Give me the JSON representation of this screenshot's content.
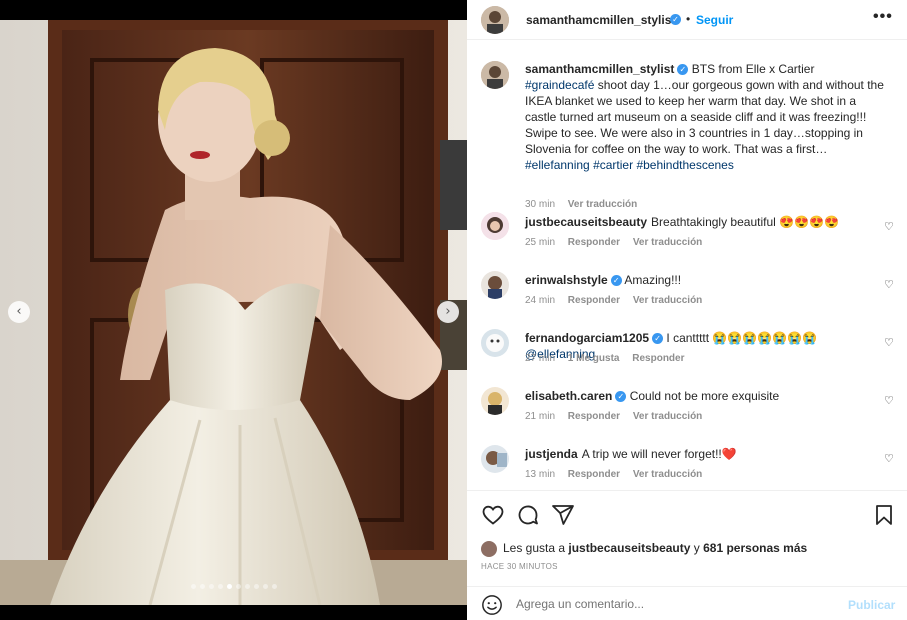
{
  "post": {
    "author": "samanthamcmillen_stylist",
    "separator": "•",
    "follow_label": "Seguir",
    "more_label": "•••"
  },
  "caption": {
    "username": "samanthamcmillen_stylist",
    "text_a": "BTS from Elle x Cartier ",
    "tag1": "#graindecafé",
    "text_b": " shoot day 1…our gorgeous gown with and without the IKEA blanket we used to keep her warm that day. We shot in a castle turned art museum on a seaside cliff and it was freezing!!! Swipe to see. We were also in 3 countries in 1 day…stopping in Slovenia for coffee on the way to work. That was a first… ",
    "tag2": "#ellefanning",
    "tag3": "#cartier",
    "tag4": "#behindthescenes",
    "time": "30 min",
    "translate": "Ver traducción"
  },
  "comments": [
    {
      "username": "justbecauseitsbeauty",
      "text": "Breathtakingly beautiful 😍😍😍😍",
      "time": "25 min",
      "reply": "Responder",
      "translate": "Ver traducción"
    },
    {
      "username": "erinwalshstyle",
      "text": "Amazing!!!",
      "time": "24 min",
      "reply": "Responder",
      "translate": "Ver traducción"
    },
    {
      "username": "fernandogarciam1205",
      "text": "I canttttt 😭😭😭😭😭😭😭",
      "mention": "@ellefanning",
      "time": "27 min",
      "likes": "1 Me gusta",
      "reply": "Responder"
    },
    {
      "username": "elisabeth.caren",
      "text": "Could not be more exquisite",
      "time": "21 min",
      "reply": "Responder",
      "translate": "Ver traducción"
    },
    {
      "username": "justjenda",
      "text": "A trip we will never forget!!❤️",
      "time": "13 min",
      "reply": "Responder",
      "translate": "Ver traducción"
    }
  ],
  "actions": {
    "likes_prefix": "Les gusta a ",
    "likes_user": "justbecauseitsbeauty",
    "likes_mid": " y ",
    "likes_count": "681 personas más",
    "posted_ago": "HACE 30 MINUTOS",
    "comment_placeholder": "Agrega un comentario...",
    "post_label": "Publicar"
  },
  "carousel": {
    "slide_count": 10,
    "active_index": 4,
    "prev_glyph": "‹",
    "next_glyph": "›"
  },
  "colors": {
    "accent": "#0095f6",
    "verified": "#3897f0",
    "hashtag": "#00376b",
    "muted": "#8e8e8e"
  },
  "icons": {
    "verified": "verified-badge-icon",
    "heart": "heart-icon",
    "comment": "comment-icon",
    "share": "share-icon",
    "save": "bookmark-icon",
    "emoji": "emoji-icon"
  }
}
